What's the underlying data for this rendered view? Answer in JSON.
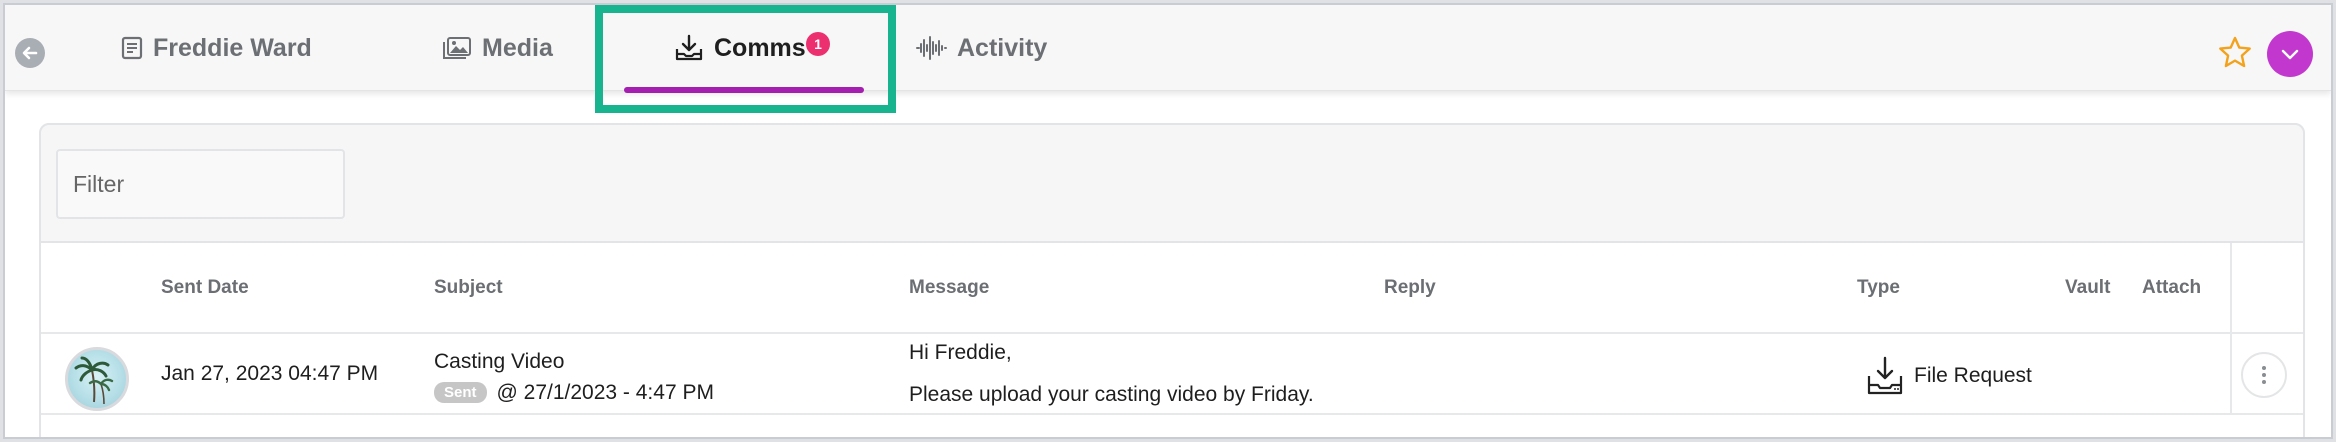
{
  "tabs": [
    {
      "label": "Freddie Ward",
      "icon": "profile-icon"
    },
    {
      "label": "Media",
      "icon": "images-icon"
    },
    {
      "label": "Comms",
      "icon": "inbox-download-icon",
      "badge": "1",
      "active": true
    },
    {
      "label": "Activity",
      "icon": "waveform-icon"
    }
  ],
  "colors": {
    "accent": "#a41fb0",
    "badge": "#ec2f6e",
    "highlight": "#17b48f",
    "star": "#f2a21b",
    "user_menu": "#c238cf"
  },
  "filter": {
    "placeholder": "Filter"
  },
  "table": {
    "columns": [
      "Sent Date",
      "Subject",
      "Message",
      "Reply",
      "Type",
      "Vault",
      "Attach"
    ],
    "rows": [
      {
        "sent_date": "Jan 27, 2023 04:47 PM",
        "subject": "Casting Video",
        "status": "Sent",
        "status_time": "@ 27/1/2023 - 4:47 PM",
        "message_line1": "Hi Freddie,",
        "message_line2": "Please upload your casting video by Friday.",
        "reply": "",
        "type": "File Request",
        "type_icon": "file-request-icon"
      }
    ]
  }
}
